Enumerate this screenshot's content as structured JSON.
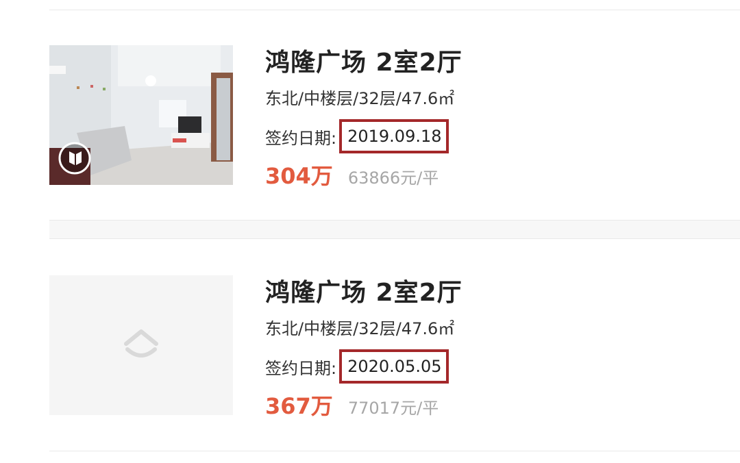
{
  "listings": [
    {
      "title": "鸿隆广场 2室2厅",
      "specs": "东北/中楼层/32层/47.6㎡",
      "sign_label": "签约日期:",
      "sign_date": "2019.09.18",
      "price": "304万",
      "unit_price": "63866元/平",
      "has_photo": true,
      "photo_badge_icon": "vr-play-icon"
    },
    {
      "title": "鸿隆广场 2室2厅",
      "specs": "东北/中楼层/32层/47.6㎡",
      "sign_label": "签约日期:",
      "sign_date": "2020.05.05",
      "price": "367万",
      "unit_price": "77017元/平",
      "has_photo": false,
      "placeholder_icon": "house-placeholder-icon"
    }
  ],
  "colors": {
    "price": "#e25b3f",
    "highlight_border": "#a4282a",
    "muted": "#a6a6a6"
  }
}
